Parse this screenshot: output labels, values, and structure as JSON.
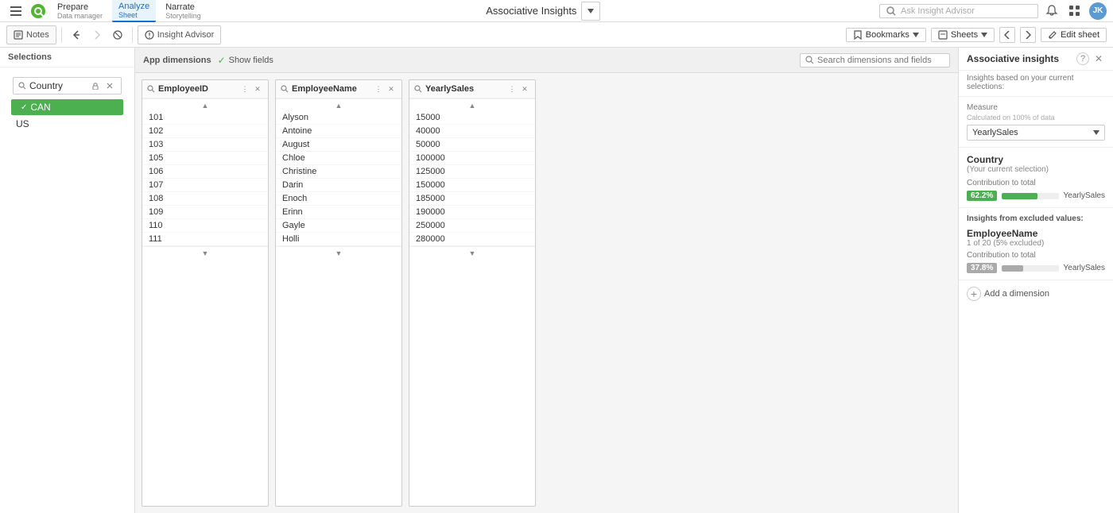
{
  "topbar": {
    "prepare_label": "Prepare",
    "prepare_sub": "Data manager",
    "analyze_label": "Analyze",
    "analyze_sub": "Sheet",
    "narrate_label": "Narrate",
    "narrate_sub": "Storytelling",
    "app_title": "Associative Insights",
    "ask_insight_placeholder": "Ask Insight Advisor",
    "user_initials": "JK"
  },
  "toolbar2": {
    "notes_label": "Notes",
    "insight_advisor_label": "Insight Advisor",
    "bookmarks_label": "Bookmarks",
    "sheets_label": "Sheets",
    "edit_sheet_label": "Edit sheet"
  },
  "selections": {
    "header": "Selections",
    "filter": {
      "label": "Country",
      "items": [
        {
          "value": "CAN",
          "selected": true
        },
        {
          "value": "US",
          "selected": false
        }
      ]
    }
  },
  "app_dimensions": {
    "label": "App dimensions",
    "show_fields_label": "Show fields",
    "search_placeholder": "Search dimensions and fields",
    "columns": [
      {
        "id": "employeeid",
        "title": "EmployeeID",
        "items": [
          "101",
          "102",
          "103",
          "105",
          "106",
          "107",
          "108",
          "109",
          "110",
          "111"
        ]
      },
      {
        "id": "employeename",
        "title": "EmployeeName",
        "items": [
          "Alyson",
          "Antoine",
          "August",
          "Chloe",
          "Christine",
          "Darin",
          "Enoch",
          "Erinn",
          "Gayle",
          "Holli"
        ]
      },
      {
        "id": "yearlysales",
        "title": "YearlySales",
        "items": [
          "15000",
          "40000",
          "50000",
          "100000",
          "125000",
          "150000",
          "185000",
          "190000",
          "250000",
          "280000"
        ]
      }
    ]
  },
  "associative_insights": {
    "title": "Associative insights",
    "subtext": "Insights based on your current selections:",
    "measure": {
      "label": "Measure",
      "sublabel": "Calculated on 100% of data",
      "value": "YearlySales"
    },
    "current_selection_card": {
      "title": "Country",
      "subtitle": "(Your current selection)",
      "contribution_label": "Contribution to total",
      "contribution_pct": "62.2%",
      "contribution_field": "YearlySales"
    },
    "excluded_section": {
      "title": "Insights from excluded values:",
      "card": {
        "title": "EmployeeName",
        "subtitle": "1 of 20 (5% excluded)",
        "contribution_label": "Contribution to total",
        "contribution_pct": "37.8%",
        "contribution_field": "YearlySales"
      }
    },
    "add_dimension_label": "Add a dimension"
  }
}
